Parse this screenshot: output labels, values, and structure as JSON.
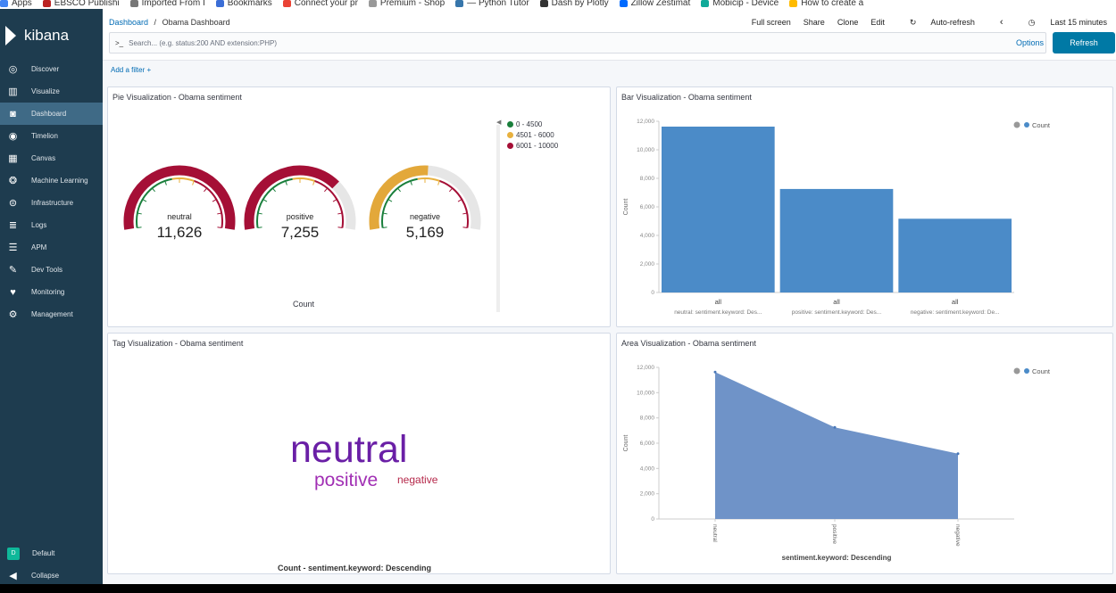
{
  "bookmarks": [
    "Apps",
    "EBSCO Publishi",
    "Imported From I",
    "Bookmarks",
    "Connect your pr",
    "Premium - Shop",
    "— Python Tutor",
    "Dash by Plotly",
    "Zillow Zestimat",
    "Mobicip - Device",
    "How to create a"
  ],
  "sidebar": {
    "brand": "kibana",
    "items": [
      {
        "label": "Discover",
        "icon": "compass-icon",
        "glyph": "◎"
      },
      {
        "label": "Visualize",
        "icon": "bar-chart-icon",
        "glyph": "▥"
      },
      {
        "label": "Dashboard",
        "icon": "dashboard-icon",
        "glyph": "◙",
        "active": true
      },
      {
        "label": "Timelion",
        "icon": "timelion-icon",
        "glyph": "◉"
      },
      {
        "label": "Canvas",
        "icon": "canvas-icon",
        "glyph": "▦"
      },
      {
        "label": "Machine Learning",
        "icon": "machine-learning-icon",
        "glyph": "❂"
      },
      {
        "label": "Infrastructure",
        "icon": "infrastructure-icon",
        "glyph": "⊜"
      },
      {
        "label": "Logs",
        "icon": "logs-icon",
        "glyph": "≣"
      },
      {
        "label": "APM",
        "icon": "apm-icon",
        "glyph": "☰"
      },
      {
        "label": "Dev Tools",
        "icon": "wrench-icon",
        "glyph": "✎"
      },
      {
        "label": "Monitoring",
        "icon": "heartbeat-icon",
        "glyph": "♥"
      },
      {
        "label": "Management",
        "icon": "gear-icon",
        "glyph": "⚙"
      }
    ],
    "space": {
      "badge": "D",
      "label": "Default"
    },
    "collapse": {
      "label": "Collapse",
      "glyph": "◀"
    }
  },
  "header": {
    "breadcrumb_root": "Dashboard",
    "breadcrumb_sep": "/",
    "breadcrumb_current": "Obama Dashboard",
    "actions": [
      "Full screen",
      "Share",
      "Clone",
      "Edit",
      "Auto-refresh"
    ],
    "time_range": "Last 15 minutes",
    "search_prompt": ">_",
    "search_placeholder": "Search... (e.g. status:200 AND extension:PHP)",
    "options_label": "Options",
    "refresh_label": "Refresh"
  },
  "filters": {
    "add_label": "Add a filter +"
  },
  "panels": {
    "pie": {
      "title": "Pie Visualization - Obama sentiment",
      "footer": "Count",
      "legend": [
        {
          "label": "0 - 4500",
          "color": "#1a7f3c"
        },
        {
          "label": "4501 - 6000",
          "color": "#e8b13e"
        },
        {
          "label": "6001 - 10000",
          "color": "#a50f36"
        }
      ],
      "gauges": [
        {
          "label": "neutral",
          "value_text": "11,626",
          "value": 11626,
          "color": "#a50f36"
        },
        {
          "label": "positive",
          "value_text": "7,255",
          "value": 7255,
          "color": "#a50f36"
        },
        {
          "label": "negative",
          "value_text": "5,169",
          "value": 5169,
          "color": "#e3a83a"
        }
      ]
    },
    "bar": {
      "title": "Bar Visualization - Obama sentiment",
      "legend": "Count"
    },
    "tag": {
      "title": "Tag Visualization - Obama sentiment",
      "footer": "Count - sentiment.keyword: Descending",
      "words": [
        {
          "text": "neutral",
          "color": "#6a1fa6"
        },
        {
          "text": "positive",
          "color": "#a12fb4"
        },
        {
          "text": "negative",
          "color": "#b5284a"
        }
      ]
    },
    "area": {
      "title": "Area Visualization - Obama sentiment",
      "legend": "Count"
    }
  },
  "chart_data": [
    {
      "type": "bar",
      "title": "Bar Visualization - Obama sentiment",
      "ylabel": "Count",
      "categories": [
        "all",
        "all",
        "all"
      ],
      "sublabels": [
        "neutral: sentiment.keyword: Des...",
        "positive: sentiment.keyword: Des...",
        "negative: sentiment.keyword: De..."
      ],
      "series": [
        {
          "name": "Count",
          "values": [
            11626,
            7255,
            5169
          ]
        }
      ],
      "ylim": [
        0,
        12000
      ],
      "yticks": [
        "0",
        "2,000",
        "4,000",
        "6,000",
        "8,000",
        "10,000",
        "12,000"
      ],
      "grid": false,
      "legend": "top-right",
      "color": "#4b8bc8"
    },
    {
      "type": "area",
      "title": "Area Visualization - Obama sentiment",
      "xlabel": "sentiment.keyword: Descending",
      "ylabel": "Count",
      "categories": [
        "neutral",
        "positive",
        "negative"
      ],
      "series": [
        {
          "name": "Count",
          "values": [
            11626,
            7255,
            5169
          ]
        }
      ],
      "ylim": [
        0,
        12000
      ],
      "yticks": [
        "0",
        "2,000",
        "4,000",
        "6,000",
        "8,000",
        "10,000",
        "12,000"
      ],
      "grid": false,
      "legend": "top-right",
      "color": "#6f93c8"
    }
  ]
}
